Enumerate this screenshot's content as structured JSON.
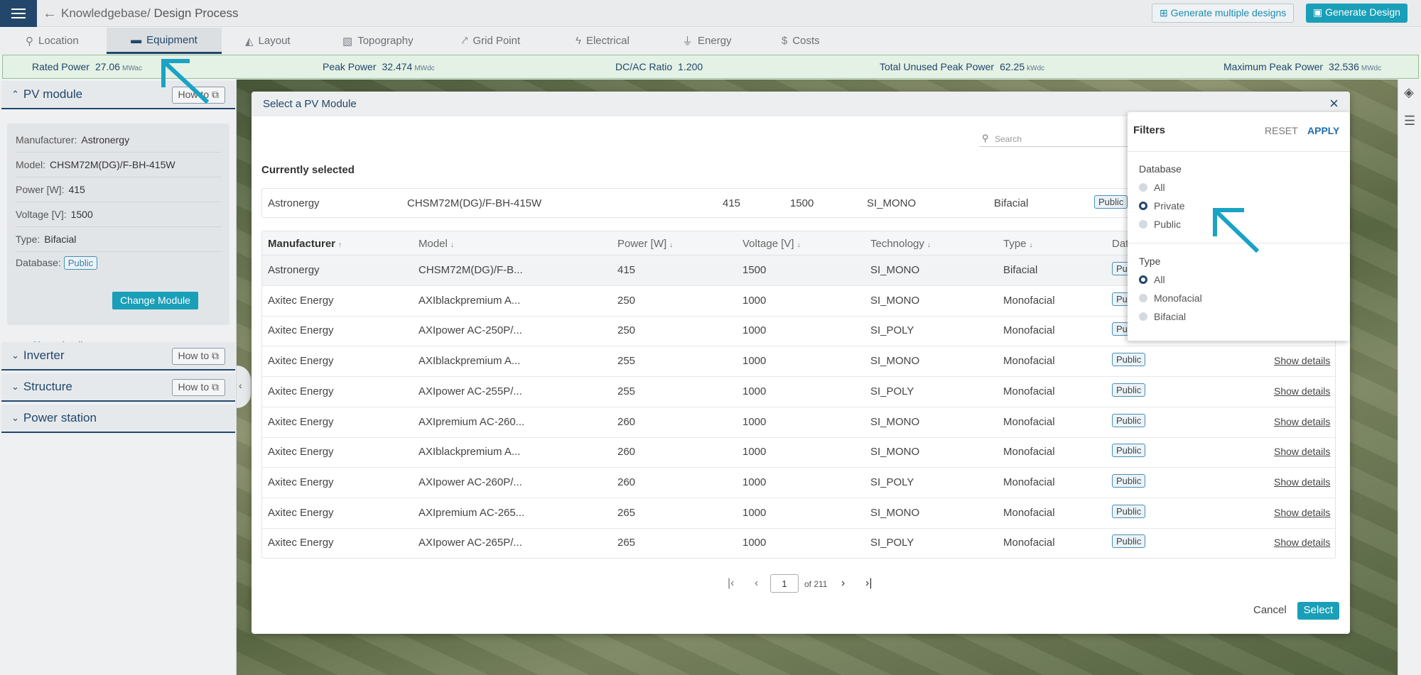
{
  "topbar": {
    "breadcrumb_parent": "Knowledgebase",
    "breadcrumb_current": "Design Process",
    "btn_generate_multiple": "Generate multiple designs",
    "btn_generate": "Generate Design"
  },
  "tabs": [
    {
      "label": "Location",
      "icon": "location-pin-icon"
    },
    {
      "label": "Equipment",
      "icon": "solar-panel-icon"
    },
    {
      "label": "Layout",
      "icon": "layout-icon"
    },
    {
      "label": "Topography",
      "icon": "topography-icon"
    },
    {
      "label": "Grid Point",
      "icon": "grid-point-icon"
    },
    {
      "label": "Electrical",
      "icon": "lightning-icon"
    },
    {
      "label": "Energy",
      "icon": "energy-tower-icon"
    },
    {
      "label": "Costs",
      "icon": "dollar-icon"
    }
  ],
  "summary": {
    "rated_power_label": "Rated Power",
    "rated_power_value": "27.06",
    "rated_power_unit": "MWac",
    "peak_power_label": "Peak Power",
    "peak_power_value": "32.474",
    "peak_power_unit": "MWdc",
    "dcac_label": "DC/AC Ratio",
    "dcac_value": "1.200",
    "unused_label": "Total Unused Peak Power",
    "unused_value": "62.25",
    "unused_unit": "kWdc",
    "max_label": "Maximum Peak Power",
    "max_value": "32.536",
    "max_unit": "MWdc"
  },
  "left": {
    "pv_title": "PV module",
    "howto": "How to",
    "manufacturer_label": "Manufacturer:",
    "manufacturer": "Astronergy",
    "model_label": "Model:",
    "model": "CHSM72M(DG)/F-BH-415W",
    "power_label": "Power [W]:",
    "power": "415",
    "voltage_label": "Voltage [V]:",
    "voltage": "1500",
    "type_label": "Type:",
    "type": "Bifacial",
    "database_label": "Database:",
    "database": "Public",
    "show_details": "Show details",
    "change_module": "Change Module",
    "inverter": "Inverter",
    "structure": "Structure",
    "power_station": "Power station"
  },
  "modal": {
    "title": "Select a PV Module",
    "search_placeholder": "Search",
    "currently_selected": "Currently selected",
    "current": {
      "manufacturer": "Astronergy",
      "model": "CHSM72M(DG)/F-BH-415W",
      "power": "415",
      "voltage": "1500",
      "technology": "SI_MONO",
      "type": "Bifacial",
      "database": "Public"
    },
    "columns": [
      "Manufacturer",
      "Model",
      "Power [W]",
      "Voltage [V]",
      "Technology",
      "Type",
      "Dat"
    ],
    "rows": [
      {
        "manufacturer": "Astronergy",
        "model": "CHSM72M(DG)/F-B...",
        "power": "415",
        "voltage": "1500",
        "technology": "SI_MONO",
        "type": "Bifacial",
        "database": "Pu",
        "details": ""
      },
      {
        "manufacturer": "Axitec Energy",
        "model": "AXIblackpremium A...",
        "power": "250",
        "voltage": "1000",
        "technology": "SI_MONO",
        "type": "Monofacial",
        "database": "Pu",
        "details": ""
      },
      {
        "manufacturer": "Axitec Energy",
        "model": "AXIpower AC-250P/...",
        "power": "250",
        "voltage": "1000",
        "technology": "SI_POLY",
        "type": "Monofacial",
        "database": "Pu",
        "details": ""
      },
      {
        "manufacturer": "Axitec Energy",
        "model": "AXIblackpremium A...",
        "power": "255",
        "voltage": "1000",
        "technology": "SI_MONO",
        "type": "Monofacial",
        "database": "Public",
        "details": "Show details"
      },
      {
        "manufacturer": "Axitec Energy",
        "model": "AXIpower AC-255P/...",
        "power": "255",
        "voltage": "1000",
        "technology": "SI_POLY",
        "type": "Monofacial",
        "database": "Public",
        "details": "Show details"
      },
      {
        "manufacturer": "Axitec Energy",
        "model": "AXIpremium AC-260...",
        "power": "260",
        "voltage": "1000",
        "technology": "SI_MONO",
        "type": "Monofacial",
        "database": "Public",
        "details": "Show details"
      },
      {
        "manufacturer": "Axitec Energy",
        "model": "AXIblackpremium A...",
        "power": "260",
        "voltage": "1000",
        "technology": "SI_MONO",
        "type": "Monofacial",
        "database": "Public",
        "details": "Show details"
      },
      {
        "manufacturer": "Axitec Energy",
        "model": "AXIpower AC-260P/...",
        "power": "260",
        "voltage": "1000",
        "technology": "SI_POLY",
        "type": "Monofacial",
        "database": "Public",
        "details": "Show details"
      },
      {
        "manufacturer": "Axitec Energy",
        "model": "AXIpremium AC-265...",
        "power": "265",
        "voltage": "1000",
        "technology": "SI_MONO",
        "type": "Monofacial",
        "database": "Public",
        "details": "Show details"
      },
      {
        "manufacturer": "Axitec Energy",
        "model": "AXIpower AC-265P/...",
        "power": "265",
        "voltage": "1000",
        "technology": "SI_POLY",
        "type": "Monofacial",
        "database": "Public",
        "details": "Show details"
      }
    ],
    "page": "1",
    "of_pages": "of 211",
    "cancel": "Cancel",
    "select": "Select"
  },
  "filters": {
    "title": "Filters",
    "reset": "RESET",
    "apply": "APPLY",
    "database_label": "Database",
    "database_options": [
      "All",
      "Private",
      "Public"
    ],
    "database_selected": "Private",
    "type_label": "Type",
    "type_options": [
      "All",
      "Monofacial",
      "Bifacial"
    ],
    "type_selected": "All"
  },
  "colors": {
    "navy": "#22476b",
    "accent": "#1a9fb8",
    "annotation": "#1aa3c4"
  }
}
